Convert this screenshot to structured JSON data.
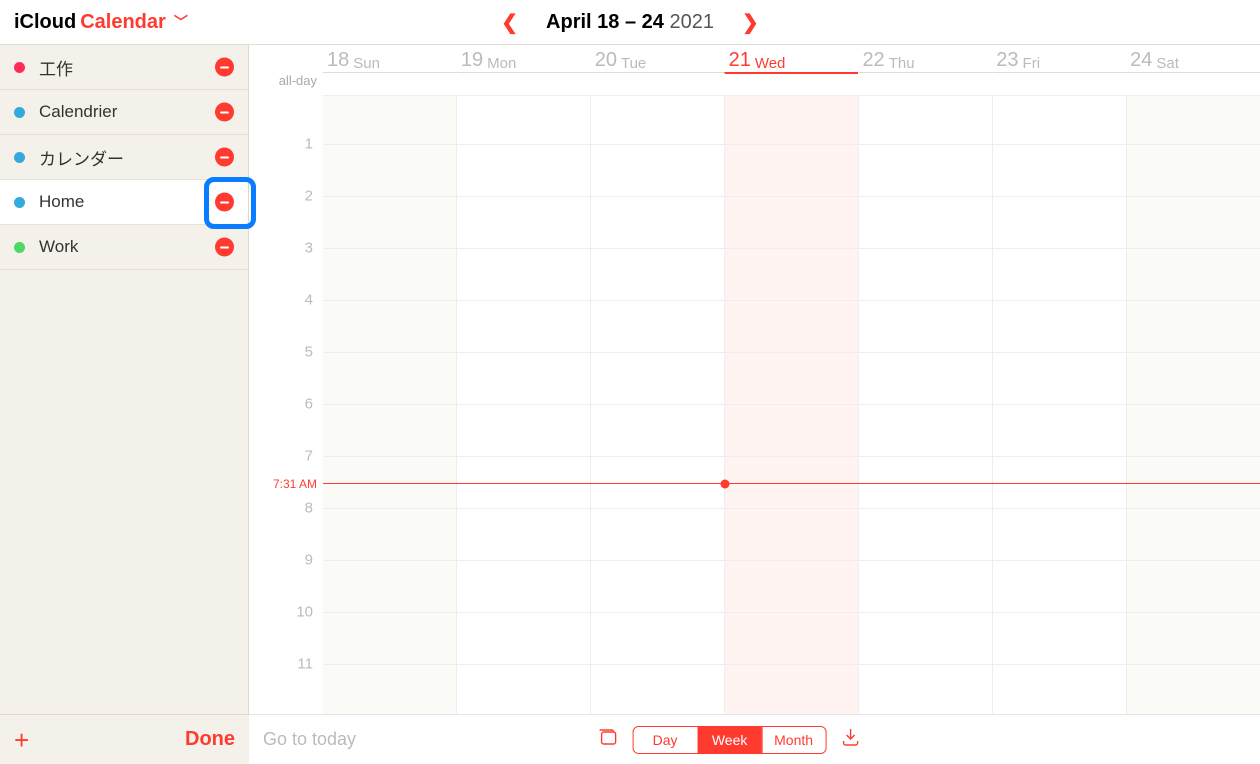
{
  "header": {
    "app_left_1": "iCloud",
    "app_left_2": "Calendar",
    "range_bold": "April 18 – 24",
    "range_year": "2021"
  },
  "sidebar": {
    "items": [
      {
        "name": "工作",
        "color": "#ff2d55"
      },
      {
        "name": "Calendrier",
        "color": "#34aadc"
      },
      {
        "name": "カレンダー",
        "color": "#34aadc"
      },
      {
        "name": "Home",
        "color": "#34aadc"
      },
      {
        "name": "Work",
        "color": "#4cd964"
      }
    ],
    "done_label": "Done"
  },
  "days": [
    {
      "num": "18",
      "abbr": "Sun",
      "weekend": true,
      "today": false
    },
    {
      "num": "19",
      "abbr": "Mon",
      "weekend": false,
      "today": false
    },
    {
      "num": "20",
      "abbr": "Tue",
      "weekend": false,
      "today": false
    },
    {
      "num": "21",
      "abbr": "Wed",
      "weekend": false,
      "today": true
    },
    {
      "num": "22",
      "abbr": "Thu",
      "weekend": false,
      "today": false
    },
    {
      "num": "23",
      "abbr": "Fri",
      "weekend": false,
      "today": false
    },
    {
      "num": "24",
      "abbr": "Sat",
      "weekend": true,
      "today": false
    }
  ],
  "allday_label": "all-day",
  "hours": [
    "1",
    "2",
    "3",
    "4",
    "5",
    "6",
    "7",
    "8",
    "9",
    "10",
    "11"
  ],
  "now": {
    "label": "7:31 AM",
    "hour": 7,
    "minute": 31,
    "today_index": 3
  },
  "footer": {
    "goto": "Go to today",
    "seg": {
      "day": "Day",
      "week": "Week",
      "month": "Month",
      "active": "week"
    }
  }
}
